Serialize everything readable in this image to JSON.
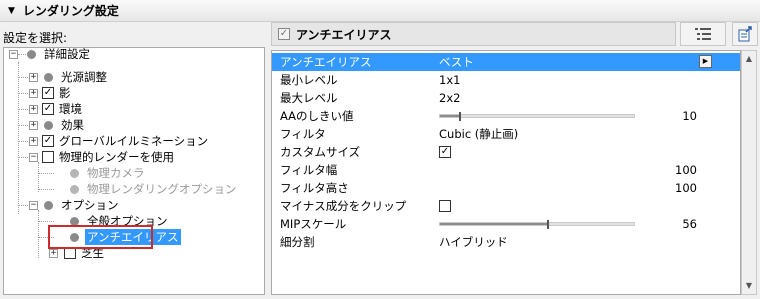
{
  "panel": {
    "title": "レンダリング設定",
    "select_label": "設定を選択:"
  },
  "tree": {
    "root": "詳細設定",
    "light": "光源調整",
    "shadow": "影",
    "environment": "環境",
    "effects": "効果",
    "gi": "グローバルイルミネーション",
    "physical": "物理的レンダーを使用",
    "physical_camera": "物理カメラ",
    "physical_render_options": "物理レンダリングオプション",
    "options": "オプション",
    "general_options": "全般オプション",
    "antialiasing": "アンチエイリアス",
    "lawn": "芝生"
  },
  "right_header": {
    "title": "アンチエイリアス"
  },
  "props": {
    "aa": {
      "label": "アンチエイリアス",
      "value": "ベスト"
    },
    "min_level": {
      "label": "最小レベル",
      "value": "1x1"
    },
    "max_level": {
      "label": "最大レベル",
      "value": "2x2"
    },
    "aa_threshold": {
      "label": "AAのしきい値",
      "value": "10"
    },
    "filter": {
      "label": "フィルタ",
      "value": "Cubic (静止画)"
    },
    "custom_size": {
      "label": "カスタムサイズ"
    },
    "filter_width": {
      "label": "フィルタ幅",
      "value": "100"
    },
    "filter_height": {
      "label": "フィルタ高さ",
      "value": "100"
    },
    "clip_negative": {
      "label": "マイナス成分をクリップ"
    },
    "mip_scale": {
      "label": "MIPスケール",
      "value": "56"
    },
    "subdivision": {
      "label": "細分割",
      "value": "ハイブリッド"
    }
  }
}
